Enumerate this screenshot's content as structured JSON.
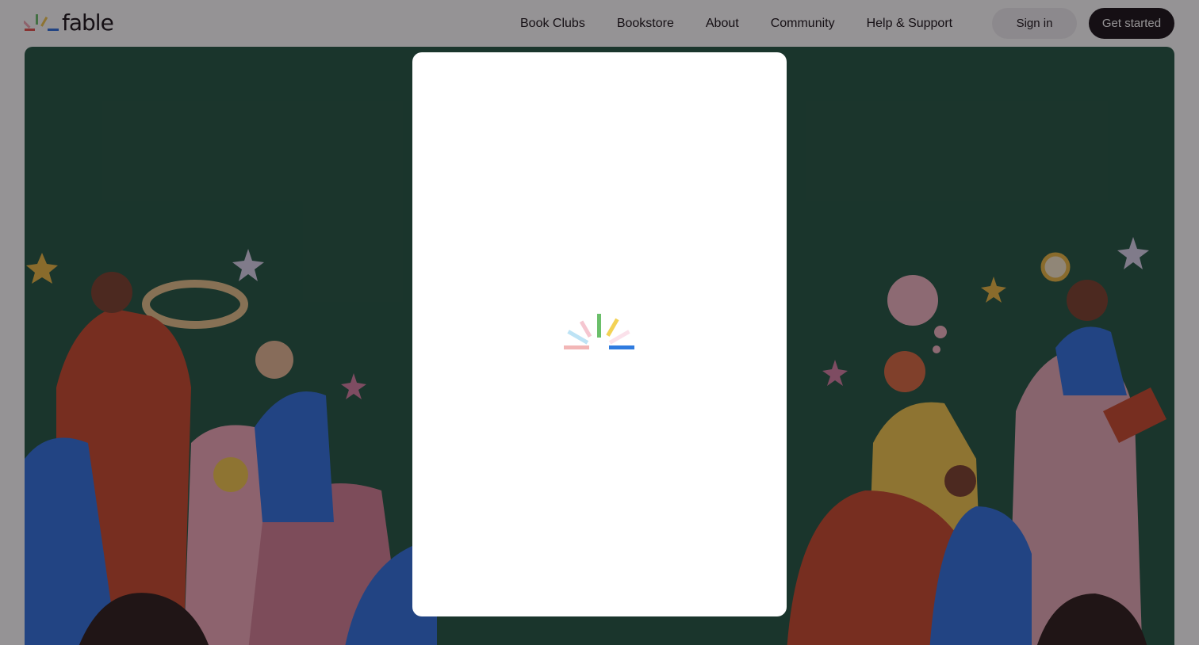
{
  "brand": {
    "name": "fable",
    "logo_colors": [
      "#e8504b",
      "#f2a7b5",
      "#6bbf6a",
      "#f3c64b",
      "#2f6fdf"
    ]
  },
  "nav": {
    "items": [
      {
        "label": "Book Clubs"
      },
      {
        "label": "Bookstore"
      },
      {
        "label": "About"
      },
      {
        "label": "Community"
      },
      {
        "label": "Help & Support"
      }
    ],
    "signin_label": "Sign in",
    "getstarted_label": "Get started"
  },
  "hero": {
    "background": "#205540"
  },
  "modal": {
    "state": "loading",
    "spinner_icon": "fable-loading-spinner-icon",
    "spinner_colors": [
      "#f2b6b6",
      "#bde3f5",
      "#f5c6d0",
      "#6bbf6a",
      "#f3d255",
      "#fbe1ea",
      "#2f7bdf"
    ]
  }
}
